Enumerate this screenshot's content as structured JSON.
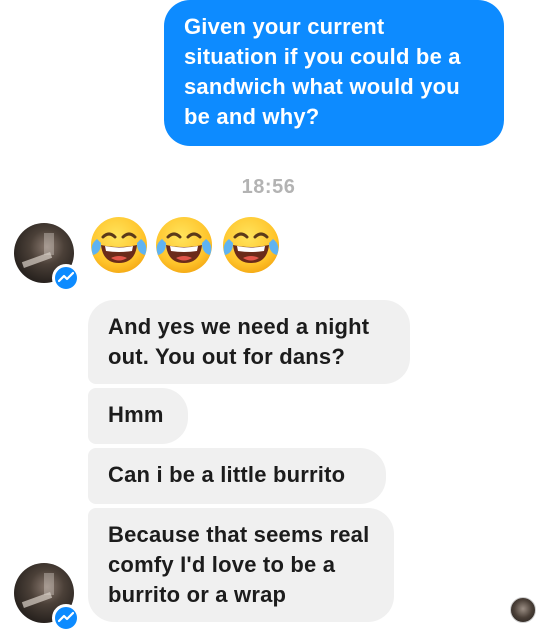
{
  "conversation": {
    "sent_message": "Given your current\nsituation if you could be a\nsandwich what would you\nbe and why?",
    "timestamp": "18:56",
    "emoji_reaction": {
      "icon": "face-with-tears-of-joy-icon",
      "count": 3
    },
    "received_messages": [
      {
        "text": "And yes we need a night\nout. You out for dans?"
      },
      {
        "text": "Hmm"
      },
      {
        "text": "Can i be a little burrito"
      },
      {
        "text": "Because that seems real\ncomfy I'd love to be a\nburrito or a wrap"
      }
    ]
  },
  "colors": {
    "sent_bubble": "#0d8bff",
    "received_bubble": "#f0f0f0",
    "timestamp": "#b3b3b3",
    "messenger_badge": "#0d8bff"
  },
  "icons": {
    "avatar": "contact-avatar",
    "badge": "messenger-icon",
    "read_receipt": "read-receipt-avatar"
  }
}
